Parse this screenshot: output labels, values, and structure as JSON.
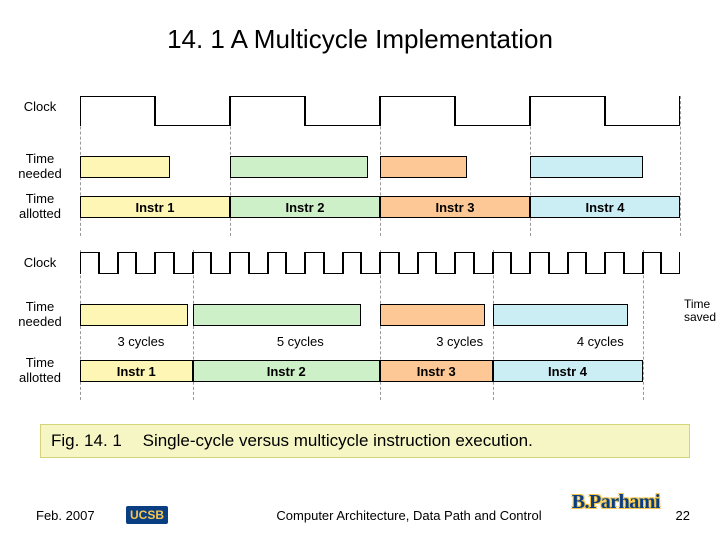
{
  "title": "14. 1  A Multicycle Implementation",
  "labels": {
    "clock": "Clock",
    "time_needed": "Time\nneeded",
    "time_allotted": "Time\nallotted",
    "time_saved": "Time\nsaved"
  },
  "single_cycle": {
    "instr": [
      "Instr 1",
      "Instr 2",
      "Instr 3",
      "Instr 4"
    ],
    "needed_fracs": [
      0.6,
      0.92,
      0.58,
      0.75
    ],
    "colors": [
      "#fdf6b5",
      "#cdf0c8",
      "#fdc896",
      "#cbeef5"
    ],
    "slot_frac": 0.25
  },
  "multi_cycle": {
    "instr": [
      "Instr 1",
      "Instr 2",
      "Instr 3",
      "Instr 4"
    ],
    "cycles": [
      3,
      5,
      3,
      4
    ],
    "cycle_labels": [
      "3 cycles",
      "5 cycles",
      "3 cycles",
      "4 cycles"
    ],
    "needed_fracs": [
      0.96,
      0.9,
      0.93,
      0.9
    ],
    "colors": [
      "#fdf6b5",
      "#cdf0c8",
      "#fdc896",
      "#cbeef5"
    ],
    "total_slots": 16
  },
  "caption": {
    "fig": "Fig. 14. 1",
    "text": "Single-cycle versus multicycle instruction execution."
  },
  "footer": {
    "date": "Feb. 2007",
    "middle": "Computer Architecture, Data Path and Control",
    "page": "22",
    "org": "UCSB",
    "author": "B.Parhami"
  }
}
